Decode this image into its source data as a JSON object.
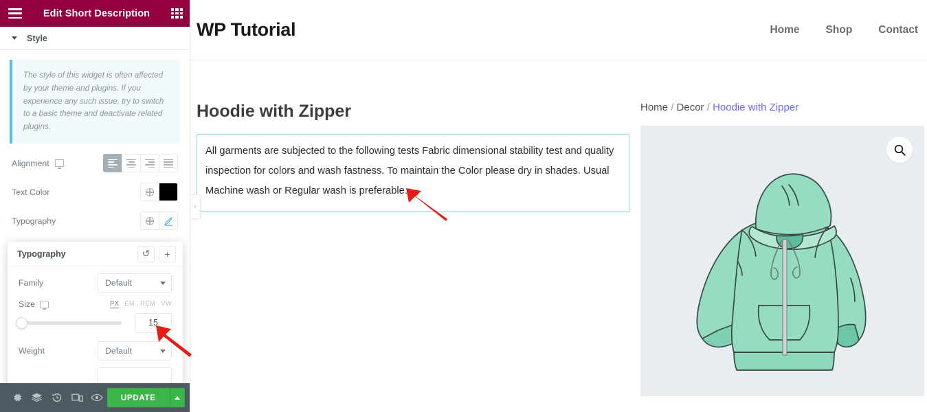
{
  "panel": {
    "header": {
      "title": "Edit Short Description",
      "menu_icon": "hamburger-icon",
      "widgets_icon": "grid-icon"
    },
    "accordion": {
      "label": "Style"
    },
    "notice": "The style of this widget is often affected by your theme and plugins. If you experience any such issue, try to switch to a basic theme and deactivate related plugins.",
    "controls": [
      {
        "label": "Alignment",
        "responsive_icon": "monitor-icon",
        "type": "button-group",
        "options": [
          "align-left",
          "align-center",
          "align-right",
          "align-justify"
        ],
        "selected": "align-left"
      },
      {
        "label": "Text Color",
        "type": "color",
        "global_icon": "globe-icon",
        "value": "#000000"
      },
      {
        "label": "Typography",
        "type": "typography",
        "global_icon": "globe-icon",
        "edit_icon": "pencil-icon"
      }
    ],
    "typography_popover": {
      "title": "Typography",
      "reset_icon": "reset-icon",
      "reset_glyph": "↺",
      "add_icon": "plus-icon",
      "add_glyph": "+",
      "family": {
        "label": "Family",
        "value": "Default"
      },
      "size": {
        "label": "Size",
        "responsive_icon": "monitor-icon",
        "units": [
          "PX",
          "EM",
          "REM",
          "VW"
        ],
        "unit_selected": "PX",
        "value": "15"
      },
      "weight": {
        "label": "Weight",
        "value": "Default"
      }
    },
    "bottom_bar": {
      "icons": [
        {
          "name": "settings-gear-icon",
          "glyph": "⚙"
        },
        {
          "name": "navigator-layers-icon",
          "glyph": "❒"
        },
        {
          "name": "history-clock-icon",
          "glyph": "↺"
        },
        {
          "name": "responsive-mode-icon",
          "glyph": "▯"
        },
        {
          "name": "preview-eye-icon",
          "glyph": "◉"
        }
      ],
      "update_label": "UPDATE",
      "update_color": "#39b54a"
    }
  },
  "preview": {
    "site": {
      "logo": "WP Tutorial",
      "nav": [
        "Home",
        "Shop",
        "Contact"
      ]
    },
    "product": {
      "title": "Hoodie with Zipper",
      "short_description": "All garments are subjected to the following tests Fabric dimensional stability test and quality inspection for colors and wash fastness. To maintain the Color please dry in shades. Usual Machine wash or Regular wash is preferable."
    },
    "breadcrumb": {
      "items": [
        "Home",
        "Decor"
      ],
      "current": "Hoodie with Zipper",
      "separator": "/"
    },
    "gallery": {
      "zoom_icon": "search-magnifier-icon",
      "image_alt": "mint green zip-up hoodie illustration",
      "background": "#e7edf1",
      "garment_color": "#95dcc0"
    },
    "collapse_handle": {
      "icon": "chevron-left-icon",
      "glyph": "‹"
    }
  },
  "annotations": {
    "arrow_color": "#e81b16",
    "arrows": [
      "points-at-description-text",
      "points-at-size-value-field"
    ]
  }
}
